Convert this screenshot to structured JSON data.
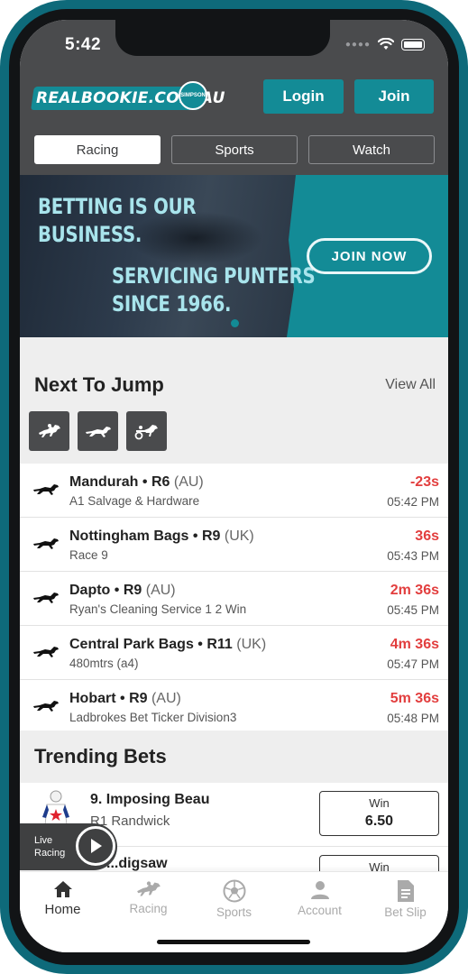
{
  "status": {
    "time": "5:42"
  },
  "header": {
    "logo_text": "REALBOOKIE.COM.AU",
    "logo_seal_text": "SIMPSON",
    "login_label": "Login",
    "join_label": "Join",
    "tabs": [
      {
        "label": "Racing",
        "active": true
      },
      {
        "label": "Sports",
        "active": false
      },
      {
        "label": "Watch",
        "active": false
      }
    ]
  },
  "banner": {
    "headline_1": "BETTING IS OUR BUSINESS.",
    "headline_2": "SERVICING PUNTERS SINCE 1966.",
    "cta_label": "JOIN NOW"
  },
  "next_to_jump": {
    "title": "Next To Jump",
    "view_all_label": "View All",
    "filters": [
      "horse-racing-icon",
      "greyhound-icon",
      "harness-racing-icon"
    ],
    "races": [
      {
        "meeting": "Mandurah",
        "race": "R6",
        "country": "(AU)",
        "subtitle": "A1 Salvage & Hardware",
        "countdown": "-23s",
        "time": "05:42 PM"
      },
      {
        "meeting": "Nottingham Bags",
        "race": "R9",
        "country": "(UK)",
        "subtitle": "Race 9",
        "countdown": "36s",
        "time": "05:43 PM"
      },
      {
        "meeting": "Dapto",
        "race": "R9",
        "country": "(AU)",
        "subtitle": "Ryan's Cleaning Service 1 2 Win",
        "countdown": "2m 36s",
        "time": "05:45 PM"
      },
      {
        "meeting": "Central Park Bags",
        "race": "R11",
        "country": "(UK)",
        "subtitle": "480mtrs (a4)",
        "countdown": "4m 36s",
        "time": "05:47 PM"
      },
      {
        "meeting": "Hobart",
        "race": "R9",
        "country": "(AU)",
        "subtitle": "Ladbrokes Bet Ticker Division3",
        "countdown": "5m 36s",
        "time": "05:48 PM"
      }
    ]
  },
  "trending": {
    "title": "Trending Bets",
    "bets": [
      {
        "runner": "9. Imposing Beau",
        "meeting": "R1 Randwick",
        "bet_type": "Win",
        "odds": "6.50"
      },
      {
        "runner": "...digsaw",
        "meeting": "",
        "bet_type": "Win",
        "odds": ""
      }
    ]
  },
  "live_racing": {
    "label_1": "Live",
    "label_2": "Racing"
  },
  "bottom_nav": [
    {
      "label": "Home",
      "icon": "home-icon",
      "active": true
    },
    {
      "label": "Racing",
      "icon": "horse-racing-icon",
      "active": false
    },
    {
      "label": "Sports",
      "icon": "soccer-ball-icon",
      "active": false
    },
    {
      "label": "Account",
      "icon": "account-icon",
      "active": false
    },
    {
      "label": "Bet Slip",
      "icon": "bet-slip-icon",
      "active": false
    }
  ],
  "colors": {
    "brand_teal": "#138b96",
    "header_grey": "#4a4b4d",
    "countdown_red": "#e23e3e"
  }
}
